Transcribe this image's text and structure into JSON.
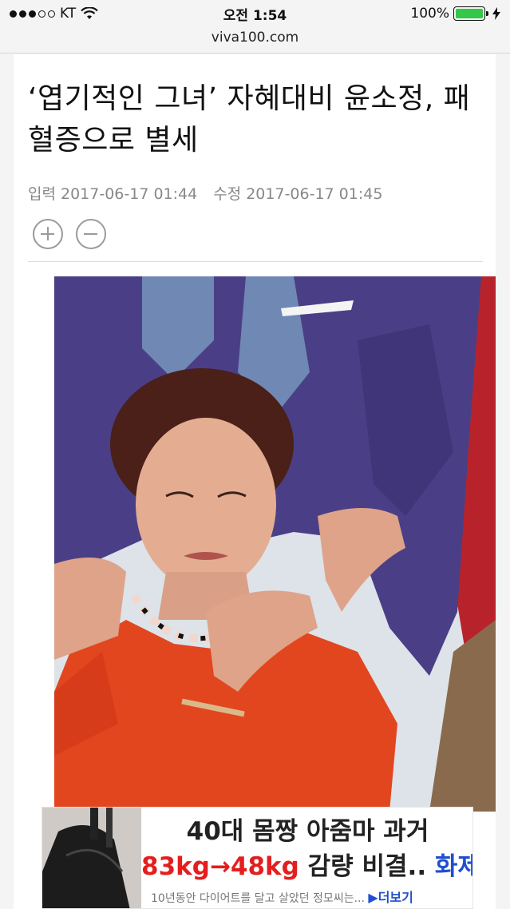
{
  "status_bar": {
    "carrier": "KT",
    "time": "오전 1:54",
    "battery_percent": "100%",
    "battery_level": 1.0,
    "icons": [
      "signal-dots-icon",
      "wifi-icon",
      "battery-icon",
      "charging-bolt-icon"
    ]
  },
  "url_bar": {
    "domain": "viva100.com"
  },
  "article": {
    "headline": "‘엽기적인 그녀’ 자혜대비 윤소정, 패혈증으로 별세",
    "published": "입력 2017-06-17 01:44",
    "modified": "수정 2017-06-17 01:45",
    "zoom_in_icon": "plus-circle-icon",
    "zoom_out_icon": "minus-circle-icon"
  },
  "ad": {
    "line1": "40대 몸짱 아줌마 과거",
    "line2_part1": "83kg→48kg",
    "line2_part2": " 감량 비결.. ",
    "line2_part3": "화제!",
    "line3": "10년동안 다이어트를 달고 살았던 정모씨는...",
    "more": "▶더보기",
    "colors": {
      "red": "#e41e1e",
      "blue": "#1f4fcf"
    }
  },
  "colors": {
    "battery_green": "#34c749",
    "meta_gray": "#888888",
    "suit_purple": "#4a3f86",
    "blouse_red": "#e2461f"
  }
}
